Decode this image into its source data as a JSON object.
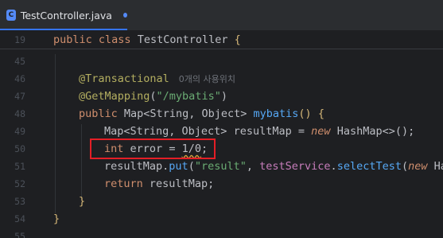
{
  "tab": {
    "file_name": "TestController.java",
    "icon_letter": "C",
    "modified": true
  },
  "sticky_line": {
    "number": "19",
    "kw_public": "public",
    "kw_class": "class",
    "class_name": "TestController",
    "brace": "{"
  },
  "lines": [
    {
      "number": "45"
    },
    {
      "number": "46",
      "annotation": "@Transactional",
      "usage_hint": "0개의 사용위치"
    },
    {
      "number": "47",
      "annotation": "@GetMapping",
      "open": "(",
      "string": "\"/mybatis\"",
      "close": ")"
    },
    {
      "number": "48",
      "kw": "public",
      "type": "Map<String, Object>",
      "method": "mybatis",
      "parens": "()",
      "brace": "{"
    },
    {
      "number": "49",
      "type": "Map<String, Object>",
      "var": "resultMap",
      "eq": "=",
      "kw_new": "new",
      "ctor": "HashMap<>();"
    },
    {
      "number": "50",
      "kw_int": "int",
      "var": "error",
      "eq": "=",
      "expr": "1/0",
      "semi": ";"
    },
    {
      "number": "51",
      "target": "resultMap",
      "call": "put",
      "open": "(",
      "string": "\"result\"",
      "comma": ",",
      "service": "testService",
      "service_call": "selectTest",
      "rest_kw": "new",
      "rest": "Ha"
    },
    {
      "number": "52",
      "kw_return": "return",
      "value": "resultMap;"
    },
    {
      "number": "53",
      "brace": "}"
    },
    {
      "number": "54",
      "brace": "}"
    },
    {
      "number": "55"
    }
  ]
}
